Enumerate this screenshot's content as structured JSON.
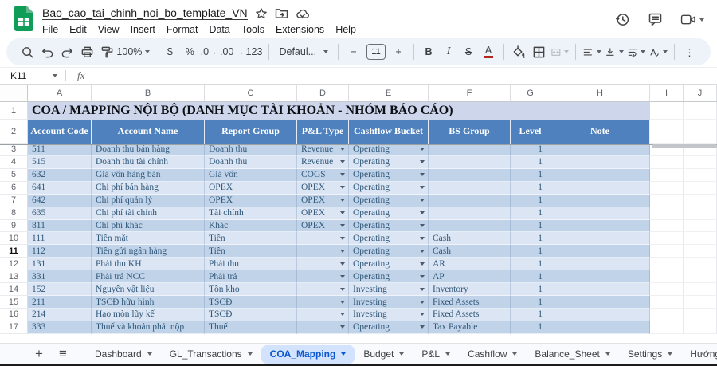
{
  "topbar": {
    "title": "Bao_cao_tai_chinh_noi_bo_template_VN",
    "menus": [
      "File",
      "Edit",
      "View",
      "Insert",
      "Format",
      "Data",
      "Tools",
      "Extensions",
      "Help"
    ]
  },
  "toolbar": {
    "zoom_value": "100%",
    "font_name": "Defaul...",
    "font_size": "11",
    "glyphs": {
      "currency": "$",
      "percent": "%",
      "decrease_decimals": ".0",
      "increase_decimals": ".00",
      "more_formats": "123",
      "bold": "B",
      "italic": "I",
      "strikethrough": "S",
      "text_color": "A",
      "minus": "−",
      "plus": "+",
      "more": "⋮"
    }
  },
  "formula_bar": {
    "cell_reference": "K11",
    "fx_label": "fx"
  },
  "sheet": {
    "column_letters": [
      "A",
      "B",
      "C",
      "D",
      "E",
      "F",
      "G",
      "H",
      "I",
      "J"
    ],
    "title_row": {
      "number": "1",
      "text": "COA / MAPPING NỘI BỘ (DANH MỤC TÀI KHOẢN - NHÓM BÁO CÁO)"
    },
    "header_row": {
      "number": "2",
      "headers": [
        "Account Code",
        "Account Name",
        "Report Group",
        "P&L Type",
        "Cashflow Bucket",
        "BS Group",
        "Level",
        "Note"
      ]
    },
    "active_row": "11",
    "rows": [
      {
        "n": "3",
        "code": "511",
        "name": "Doanh thu bán hàng",
        "report_group": "Doanh thu",
        "pl_type": "Revenue",
        "cashflow": "Operating",
        "bs_group": "",
        "level": "1",
        "note": ""
      },
      {
        "n": "4",
        "code": "515",
        "name": "Doanh thu tài chính",
        "report_group": "Doanh thu",
        "pl_type": "Revenue",
        "cashflow": "Operating",
        "bs_group": "",
        "level": "1",
        "note": ""
      },
      {
        "n": "5",
        "code": "632",
        "name": "Giá vốn hàng bán",
        "report_group": "Giá vốn",
        "pl_type": "COGS",
        "cashflow": "Operating",
        "bs_group": "",
        "level": "1",
        "note": ""
      },
      {
        "n": "6",
        "code": "641",
        "name": "Chi phí bán hàng",
        "report_group": "OPEX",
        "pl_type": "OPEX",
        "cashflow": "Operating",
        "bs_group": "",
        "level": "1",
        "note": ""
      },
      {
        "n": "7",
        "code": "642",
        "name": "Chi phí quản lý",
        "report_group": "OPEX",
        "pl_type": "OPEX",
        "cashflow": "Operating",
        "bs_group": "",
        "level": "1",
        "note": ""
      },
      {
        "n": "8",
        "code": "635",
        "name": "Chi phí tài chính",
        "report_group": "Tài chính",
        "pl_type": "OPEX",
        "cashflow": "Operating",
        "bs_group": "",
        "level": "1",
        "note": ""
      },
      {
        "n": "9",
        "code": "811",
        "name": "Chi phí khác",
        "report_group": "Khác",
        "pl_type": "OPEX",
        "cashflow": "Operating",
        "bs_group": "",
        "level": "1",
        "note": ""
      },
      {
        "n": "10",
        "code": "111",
        "name": "Tiền mặt",
        "report_group": "Tiền",
        "pl_type": "",
        "cashflow": "Operating",
        "bs_group": "Cash",
        "level": "1",
        "note": ""
      },
      {
        "n": "11",
        "code": "112",
        "name": "Tiền gửi ngân hàng",
        "report_group": "Tiền",
        "pl_type": "",
        "cashflow": "Operating",
        "bs_group": "Cash",
        "level": "1",
        "note": ""
      },
      {
        "n": "12",
        "code": "131",
        "name": "Phải thu KH",
        "report_group": "Phải thu",
        "pl_type": "",
        "cashflow": "Operating",
        "bs_group": "AR",
        "level": "1",
        "note": ""
      },
      {
        "n": "13",
        "code": "331",
        "name": "Phải trả NCC",
        "report_group": "Phải trả",
        "pl_type": "",
        "cashflow": "Operating",
        "bs_group": "AP",
        "level": "1",
        "note": ""
      },
      {
        "n": "14",
        "code": "152",
        "name": "Nguyên vật liệu",
        "report_group": "Tồn kho",
        "pl_type": "",
        "cashflow": "Investing",
        "bs_group": "Inventory",
        "level": "1",
        "note": ""
      },
      {
        "n": "15",
        "code": "211",
        "name": "TSCĐ hữu hình",
        "report_group": "TSCĐ",
        "pl_type": "",
        "cashflow": "Investing",
        "bs_group": "Fixed Assets",
        "level": "1",
        "note": ""
      },
      {
        "n": "16",
        "code": "214",
        "name": "Hao mòn lũy kế",
        "report_group": "TSCĐ",
        "pl_type": "",
        "cashflow": "Investing",
        "bs_group": "Fixed Assets",
        "level": "1",
        "note": ""
      },
      {
        "n": "17",
        "code": "333",
        "name": "Thuế và khoản phải nộp",
        "report_group": "Thuế",
        "pl_type": "",
        "cashflow": "Operating",
        "bs_group": "Tax Payable",
        "level": "1",
        "note": ""
      }
    ]
  },
  "sheetbar": {
    "add_label": "+",
    "all_sheets_label": "≡",
    "tabs": [
      "Dashboard",
      "GL_Transactions",
      "COA_Mapping",
      "Budget",
      "P&L",
      "Cashflow",
      "Balance_Sheet",
      "Settings",
      "Hướng"
    ],
    "active_tab": "COA_Mapping"
  },
  "colors": {
    "header_bg": "#4e81bd",
    "band_dark": "#c0d3e9",
    "band_light": "#dbe5f3",
    "title_bg": "#cdd6eb",
    "data_text": "#30587a",
    "active_tab_bg": "#d3e3fd",
    "active_tab_text": "#0b57d0",
    "logo_green": "#0f9d58"
  }
}
